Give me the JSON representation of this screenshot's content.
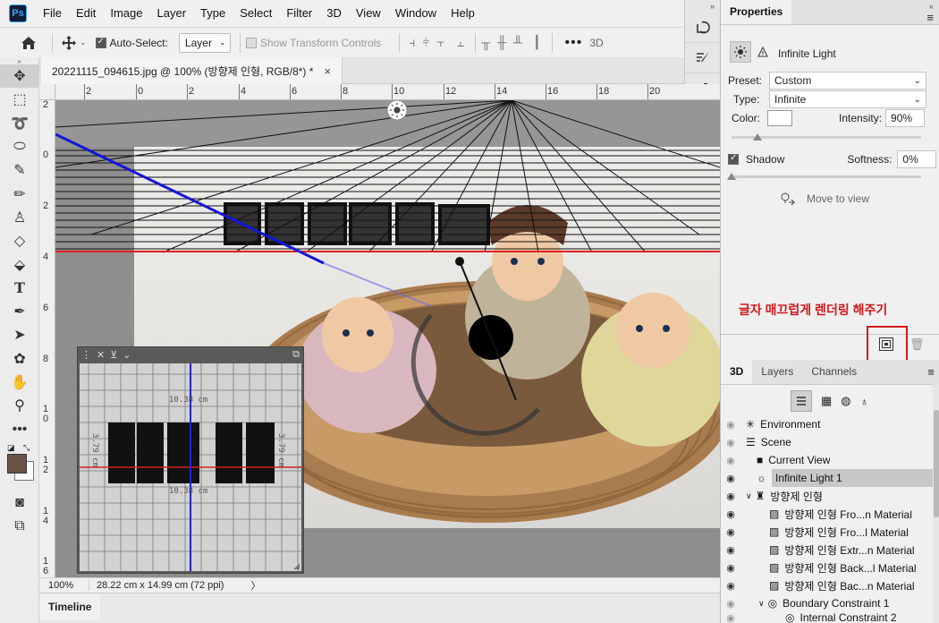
{
  "menu": [
    "File",
    "Edit",
    "Image",
    "Layer",
    "Type",
    "Select",
    "Filter",
    "3D",
    "View",
    "Window",
    "Help"
  ],
  "options": {
    "auto_select_label": "Auto-Select:",
    "auto_select_value": "Layer",
    "show_transform_label": "Show Transform Controls",
    "mode_3d": "3D"
  },
  "document": {
    "tab_title": "20221115_094615.jpg @ 100% (방향제 인형, RGB/8*) *",
    "close_glyph": "×",
    "zoom": "100%",
    "doc_info": "28.22 cm x 14.99 cm (72 ppi)",
    "hruler_ticks": [
      "2",
      "0",
      "2",
      "4",
      "6",
      "8",
      "10",
      "12",
      "14",
      "16",
      "18",
      "20"
    ],
    "vruler_ticks": [
      "2",
      "0",
      "2",
      "4",
      "6",
      "8",
      "1\n0",
      "1\n2",
      "1\n4",
      "1\n6"
    ]
  },
  "float_panel": {
    "dimension_top": "10.38 cm",
    "dimension_bottom": "10.38 cm",
    "dimension_left": "3.79 cm",
    "dimension_right": "3.79 cm"
  },
  "properties": {
    "tab": "Properties",
    "light_name": "Infinite Light",
    "preset_label": "Preset:",
    "preset_value": "Custom",
    "type_label": "Type:",
    "type_value": "Infinite",
    "color_label": "Color:",
    "intensity_label": "Intensity:",
    "intensity_value": "90%",
    "shadow_label": "Shadow",
    "softness_label": "Softness:",
    "softness_value": "0%",
    "move_to_view": "Move to view",
    "annotation": "글자 매끄럽게 렌더링 해주기"
  },
  "layers_panel": {
    "tabs": [
      "3D",
      "Layers",
      "Channels"
    ],
    "rows": [
      {
        "label": "Environment"
      },
      {
        "label": "Scene"
      },
      {
        "label": "Current View"
      },
      {
        "label": "Infinite Light 1"
      },
      {
        "label": "방향제 인형"
      },
      {
        "label": "방향제 인형 Fro...n Material"
      },
      {
        "label": "방향제 인형 Fro...l Material"
      },
      {
        "label": "방향제 인형 Extr...n Material"
      },
      {
        "label": "방향제 인형 Back...l Material"
      },
      {
        "label": "방향제 인형 Bac...n Material"
      },
      {
        "label": "Boundary Constraint 1"
      },
      {
        "label": "Internal Constraint 2"
      }
    ]
  },
  "timeline": {
    "label": "Timeline"
  },
  "colors": {
    "accent_red": "#d0181a",
    "selection": "#c8c8c8"
  }
}
